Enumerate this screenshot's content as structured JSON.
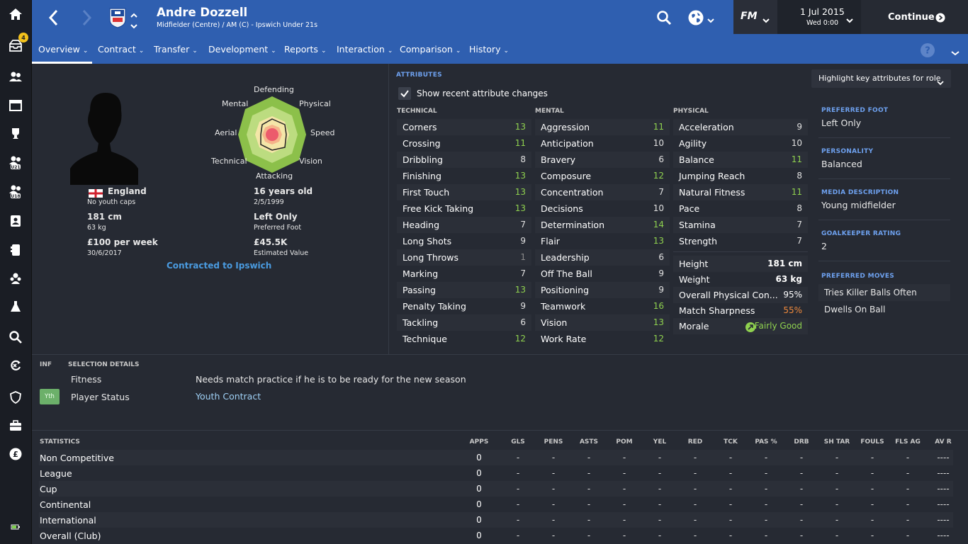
{
  "sidebar": {
    "inbox_badge": "4"
  },
  "header": {
    "player_name": "Andre Dozzell",
    "subtitle": "Midfielder (Centre) / AM (C) - Ipswich Under 21s",
    "fm_logo": "FM",
    "date": "1 Jul 2015",
    "time": "Wed 0:00",
    "continue_label": "Continue"
  },
  "nav": [
    {
      "label": "Overview"
    },
    {
      "label": "Contract"
    },
    {
      "label": "Transfer"
    },
    {
      "label": "Development"
    },
    {
      "label": "Reports"
    },
    {
      "label": "Interaction"
    },
    {
      "label": "Comparison"
    },
    {
      "label": "History"
    }
  ],
  "profile": {
    "nation": "England",
    "youth_caps": "No youth caps",
    "height": "181 cm",
    "weight": "63 kg",
    "wage": "£100 per week",
    "contract_end": "30/6/2017",
    "age": "16 years old",
    "dob": "2/5/1999",
    "foot": "Left Only",
    "foot_label": "Preferred Foot",
    "value": "£45.5K",
    "value_label": "Estimated Value",
    "contracted": "Contracted to Ipswich"
  },
  "radar": {
    "labels": [
      "Defending",
      "Physical",
      "Speed",
      "Vision",
      "Attacking",
      "Technical",
      "Aerial",
      "Mental"
    ]
  },
  "attributes": {
    "section_label": "ATTRIBUTES",
    "show_changes": "Show recent attribute changes",
    "highlight_dropdown": "Highlight key attributes for role",
    "technical_label": "TECHNICAL",
    "mental_label": "MENTAL",
    "physical_label": "PHYSICAL",
    "technical": [
      {
        "name": "Corners",
        "value": "13"
      },
      {
        "name": "Crossing",
        "value": "11"
      },
      {
        "name": "Dribbling",
        "value": "8"
      },
      {
        "name": "Finishing",
        "value": "13"
      },
      {
        "name": "First Touch",
        "value": "13"
      },
      {
        "name": "Free Kick Taking",
        "value": "13"
      },
      {
        "name": "Heading",
        "value": "7"
      },
      {
        "name": "Long Shots",
        "value": "9"
      },
      {
        "name": "Long Throws",
        "value": "1"
      },
      {
        "name": "Marking",
        "value": "7"
      },
      {
        "name": "Passing",
        "value": "13"
      },
      {
        "name": "Penalty Taking",
        "value": "9"
      },
      {
        "name": "Tackling",
        "value": "6"
      },
      {
        "name": "Technique",
        "value": "12"
      }
    ],
    "mental": [
      {
        "name": "Aggression",
        "value": "11"
      },
      {
        "name": "Anticipation",
        "value": "10"
      },
      {
        "name": "Bravery",
        "value": "6"
      },
      {
        "name": "Composure",
        "value": "12"
      },
      {
        "name": "Concentration",
        "value": "7"
      },
      {
        "name": "Decisions",
        "value": "10"
      },
      {
        "name": "Determination",
        "value": "14"
      },
      {
        "name": "Flair",
        "value": "13"
      },
      {
        "name": "Leadership",
        "value": "6"
      },
      {
        "name": "Off The Ball",
        "value": "9"
      },
      {
        "name": "Positioning",
        "value": "9"
      },
      {
        "name": "Teamwork",
        "value": "16"
      },
      {
        "name": "Vision",
        "value": "13"
      },
      {
        "name": "Work Rate",
        "value": "12"
      }
    ],
    "physical": [
      {
        "name": "Acceleration",
        "value": "9"
      },
      {
        "name": "Agility",
        "value": "10"
      },
      {
        "name": "Balance",
        "value": "11"
      },
      {
        "name": "Jumping Reach",
        "value": "8"
      },
      {
        "name": "Natural Fitness",
        "value": "11"
      },
      {
        "name": "Pace",
        "value": "8"
      },
      {
        "name": "Stamina",
        "value": "7"
      },
      {
        "name": "Strength",
        "value": "7"
      }
    ],
    "physical_extra": [
      {
        "name": "Height",
        "value": "181 cm"
      },
      {
        "name": "Weight",
        "value": "63 kg"
      },
      {
        "name": "Overall Physical Con...",
        "value": "95%"
      },
      {
        "name": "Match Sharpness",
        "value": "55%"
      },
      {
        "name": "Morale",
        "value": "Fairly Good"
      }
    ]
  },
  "info": {
    "preferred_foot_label": "PREFERRED FOOT",
    "preferred_foot": "Left Only",
    "personality_label": "PERSONALITY",
    "personality": "Balanced",
    "media_label": "MEDIA DESCRIPTION",
    "media": "Young midfielder",
    "gk_label": "GOALKEEPER RATING",
    "gk": "2",
    "moves_label": "PREFERRED MOVES",
    "moves": [
      "Tries Killer Balls Often",
      "Dwells On Ball"
    ]
  },
  "selection": {
    "inf_label": "INF",
    "label": "SELECTION DETAILS",
    "fitness_label": "Fitness",
    "fitness_text": "Needs match practice if he is to be ready for the new season",
    "status_badge": "Yth",
    "status_label": "Player Status",
    "status_text": "Youth Contract"
  },
  "statistics": {
    "label": "STATISTICS",
    "headers": [
      "APPS",
      "GLS",
      "PENS",
      "ASTS",
      "POM",
      "YEL",
      "RED",
      "TCK",
      "PAS %",
      "DRB",
      "SH TAR",
      "FOULS",
      "FLS AG",
      "AV R"
    ],
    "rows": [
      {
        "name": "Non Competitive",
        "cells": [
          "0",
          "-",
          "-",
          "-",
          "-",
          "-",
          "-",
          "-",
          "-",
          "-",
          "-",
          "-",
          "-",
          "----"
        ]
      },
      {
        "name": "League",
        "cells": [
          "0",
          "-",
          "-",
          "-",
          "-",
          "-",
          "-",
          "-",
          "-",
          "-",
          "-",
          "-",
          "-",
          "----"
        ]
      },
      {
        "name": "Cup",
        "cells": [
          "0",
          "-",
          "-",
          "-",
          "-",
          "-",
          "-",
          "-",
          "-",
          "-",
          "-",
          "-",
          "-",
          "----"
        ]
      },
      {
        "name": "Continental",
        "cells": [
          "0",
          "-",
          "-",
          "-",
          "-",
          "-",
          "-",
          "-",
          "-",
          "-",
          "-",
          "-",
          "-",
          "----"
        ]
      },
      {
        "name": "International",
        "cells": [
          "0",
          "-",
          "-",
          "-",
          "-",
          "-",
          "-",
          "-",
          "-",
          "-",
          "-",
          "-",
          "-",
          "----"
        ]
      },
      {
        "name": "Overall (Club)",
        "cells": [
          "0",
          "-",
          "-",
          "-",
          "-",
          "-",
          "-",
          "-",
          "-",
          "-",
          "-",
          "-",
          "-",
          "----"
        ]
      }
    ]
  },
  "colors": {
    "header_blue": "#2f5fb0",
    "attr_green": "#8fd14f",
    "sharpness_orange": "#f08a3c",
    "link_blue": "#4a9be0"
  }
}
